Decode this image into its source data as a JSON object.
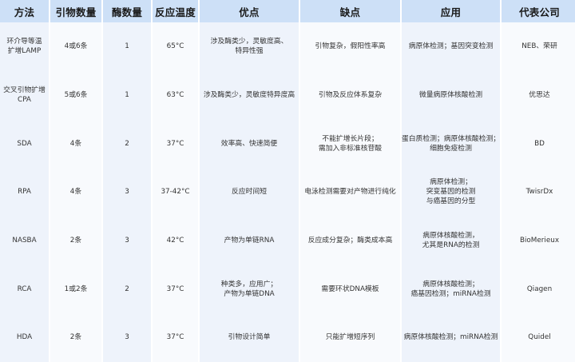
{
  "headers": [
    "方法",
    "引物数量",
    "酶数量",
    "反应温度",
    "优点",
    "缺点",
    "应用",
    "代表公司"
  ],
  "rows": [
    [
      [
        "环介导等温",
        "扩增LAMP"
      ],
      [
        "4或6条"
      ],
      [
        "1"
      ],
      [
        "65°C"
      ],
      [
        "涉及酶类少，灵敏度高、",
        "特异性强"
      ],
      [
        "引物复杂，假阳性率高"
      ],
      [
        "病原体检测；基因突变检测"
      ],
      [
        "NEB、荣研"
      ]
    ],
    [
      [
        "交叉引物扩增",
        "CPA"
      ],
      [
        "5或6条"
      ],
      [
        "1"
      ],
      [
        "63°C"
      ],
      [
        "涉及酶类少，灵敏度特异度高"
      ],
      [
        "引物及反应体系复杂"
      ],
      [
        "微量病原体核酸检测"
      ],
      [
        "优思达"
      ]
    ],
    [
      [
        "SDA"
      ],
      [
        "4条"
      ],
      [
        "2"
      ],
      [
        "37°C"
      ],
      [
        "效率高、快速简便"
      ],
      [
        "不能扩增长片段；",
        "需加入非标准核苷酸"
      ],
      [
        "蛋白质检测；病原体核酸检测；",
        "细胞免疫检测"
      ],
      [
        "BD"
      ]
    ],
    [
      [
        "RPA"
      ],
      [
        "4条"
      ],
      [
        "3"
      ],
      [
        "37-42°C"
      ],
      [
        "反应时间短"
      ],
      [
        "电泳检测需要对产物进行纯化"
      ],
      [
        "病原体检测；",
        "突变基因的检测",
        "与癌基因的分型"
      ],
      [
        "TwisrDx"
      ]
    ],
    [
      [
        "NASBA"
      ],
      [
        "2条"
      ],
      [
        "3"
      ],
      [
        "42°C"
      ],
      [
        "产物为单链RNA"
      ],
      [
        "反应成分复杂；酶类成本高"
      ],
      [
        "病原体核酸检测，",
        "尤其是RNA的检测"
      ],
      [
        "BioMerieux"
      ]
    ],
    [
      [
        "RCA"
      ],
      [
        "1或2条"
      ],
      [
        "2"
      ],
      [
        "37°C"
      ],
      [
        "种类多，应用广；",
        "产物为单链DNA"
      ],
      [
        "需要环状DNA模板"
      ],
      [
        "病原体核酸检测；",
        "癌基因检测；miRNA检测"
      ],
      [
        "Qiagen"
      ]
    ],
    [
      [
        "HDA"
      ],
      [
        "2条"
      ],
      [
        "3"
      ],
      [
        "37°C"
      ],
      [
        "引物设计简单"
      ],
      [
        "只能扩增短序列"
      ],
      [
        "病原体核酸检测；miRNA检测"
      ],
      [
        "Quidel"
      ]
    ]
  ]
}
